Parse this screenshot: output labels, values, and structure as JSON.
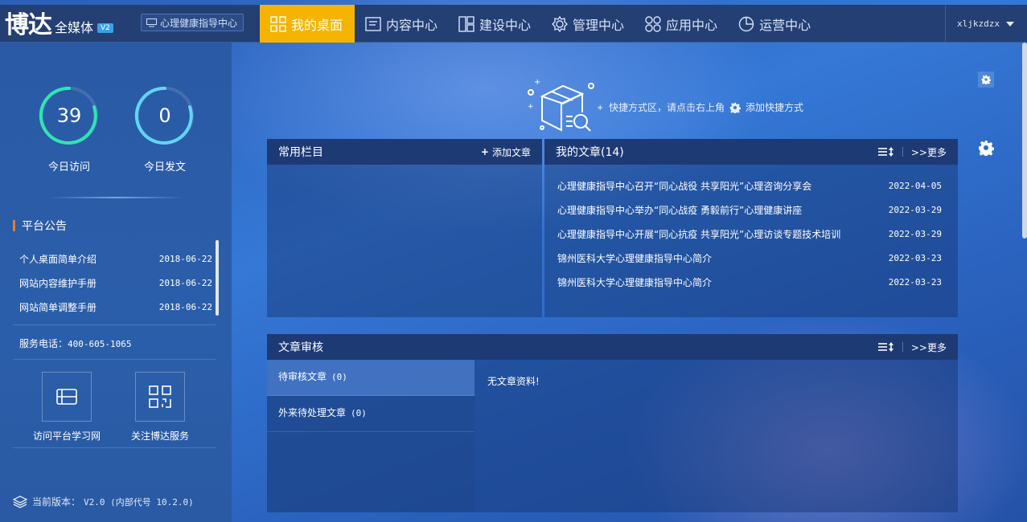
{
  "header": {
    "logo_main": "博达",
    "logo_sub": "全媒体",
    "logo_version": "V2",
    "site_name": "心理健康指导中心",
    "nav": [
      {
        "label": "我的桌面"
      },
      {
        "label": "内容中心"
      },
      {
        "label": "建设中心"
      },
      {
        "label": "管理中心"
      },
      {
        "label": "应用中心"
      },
      {
        "label": "运营中心"
      }
    ],
    "username": "xljkzdzx"
  },
  "sidebar": {
    "stats": [
      {
        "value": "39",
        "label": "今日访问"
      },
      {
        "value": "0",
        "label": "今日发文"
      }
    ],
    "notice_title": "平台公告",
    "notices": [
      {
        "title": "个人桌面简单介绍",
        "date": "2018-06-22"
      },
      {
        "title": "网站内容维护手册",
        "date": "2018-06-22"
      },
      {
        "title": "网站简单调整手册",
        "date": "2018-06-22"
      }
    ],
    "phone_label": "服务电话：",
    "phone_number": "400-605-1065",
    "quick_links": [
      {
        "label": "访问平台学习网"
      },
      {
        "label": "关注博达服务"
      }
    ],
    "version_label": "当前版本：",
    "version_value": "V2.0 (内部代号 10.2.0)"
  },
  "shortcut": {
    "text": "快捷方式区，请点击右上角",
    "add_label": "添加快捷方式"
  },
  "columns_panel": {
    "title": "常用栏目",
    "add_label": "添加文章"
  },
  "articles_panel": {
    "title": "我的文章",
    "count": "(14)",
    "more_label": ">>更多",
    "items": [
      {
        "title": "心理健康指导中心召开“同心战役 共享阳光”心理咨询分享会",
        "date": "2022-04-05"
      },
      {
        "title": "心理健康指导中心举办“同心战疫 勇毅前行”心理健康讲座",
        "date": "2022-03-29"
      },
      {
        "title": "心理健康指导中心开展“同心抗疫 共享阳光”心理访谈专题技术培训",
        "date": "2022-03-29"
      },
      {
        "title": "锦州医科大学心理健康指导中心简介",
        "date": "2022-03-23"
      },
      {
        "title": "锦州医科大学心理健康指导中心简介",
        "date": "2022-03-23"
      }
    ]
  },
  "audit_panel": {
    "title": "文章审核",
    "more_label": ">>更多",
    "tabs": [
      {
        "label": "待审核文章",
        "count": "(0)"
      },
      {
        "label": "外来待处理文章",
        "count": "(0)"
      }
    ],
    "empty_text": "无文章资料!"
  }
}
